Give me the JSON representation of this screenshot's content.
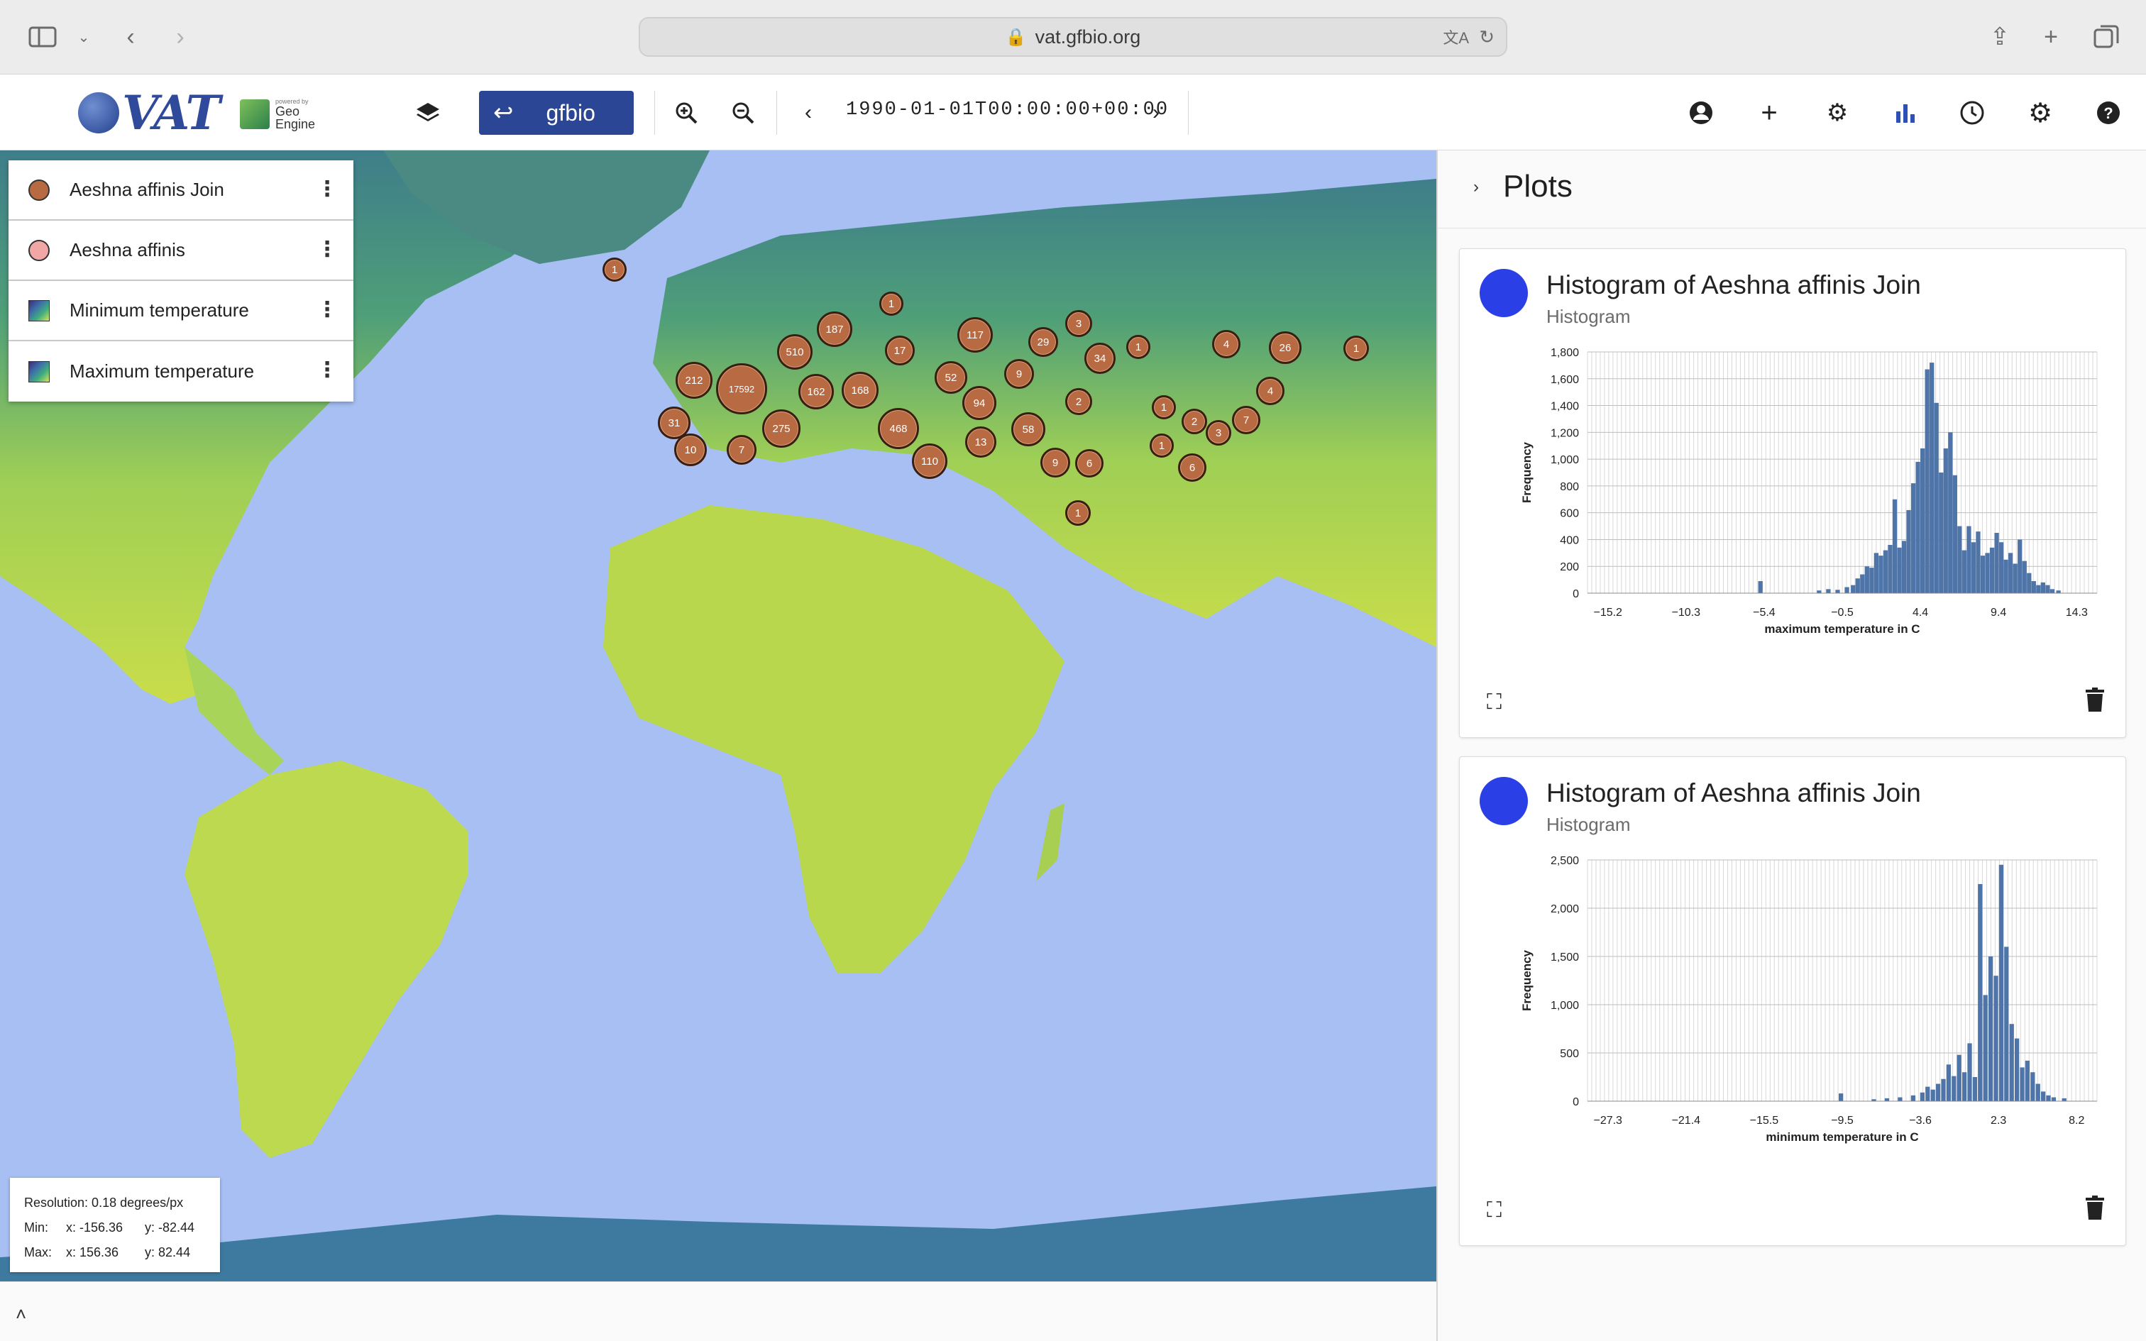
{
  "browser": {
    "url": "vat.gfbio.org"
  },
  "toolbar": {
    "gfbio_label": "gfbio",
    "time": "1990-01-01T00:00:00+00:00"
  },
  "layers": [
    {
      "name": "Aeshna affinis Join",
      "symbol": "point",
      "color": "#b86a43"
    },
    {
      "name": "Aeshna affinis",
      "symbol": "point",
      "color": "#f2a7a7"
    },
    {
      "name": "Minimum temperature",
      "symbol": "raster"
    },
    {
      "name": "Maximum temperature",
      "symbol": "raster"
    }
  ],
  "clusters": [
    {
      "label": "1"
    },
    {
      "label": "1"
    },
    {
      "label": "187"
    },
    {
      "label": "510"
    },
    {
      "label": "17"
    },
    {
      "label": "117"
    },
    {
      "label": "3"
    },
    {
      "label": "29"
    },
    {
      "label": "34"
    },
    {
      "label": "1"
    },
    {
      "label": "4"
    },
    {
      "label": "26"
    },
    {
      "label": "1"
    },
    {
      "label": "212"
    },
    {
      "label": "17592"
    },
    {
      "label": "162"
    },
    {
      "label": "168"
    },
    {
      "label": "52"
    },
    {
      "label": "9"
    },
    {
      "label": "94"
    },
    {
      "label": "2"
    },
    {
      "label": "1"
    },
    {
      "label": "2"
    },
    {
      "label": "7"
    },
    {
      "label": "4"
    },
    {
      "label": "3"
    },
    {
      "label": "31"
    },
    {
      "label": "275"
    },
    {
      "label": "468"
    },
    {
      "label": "58"
    },
    {
      "label": "13"
    },
    {
      "label": "1"
    },
    {
      "label": "10"
    },
    {
      "label": "7"
    },
    {
      "label": "110"
    },
    {
      "label": "9"
    },
    {
      "label": "6"
    },
    {
      "label": "6"
    },
    {
      "label": "1"
    }
  ],
  "info": {
    "resolution": "Resolution: 0.18 degrees/px",
    "min_label": "Min:",
    "min_x": "x: -156.36",
    "min_y": "y: -82.44",
    "max_label": "Max:",
    "max_x": "x: 156.36",
    "max_y": "y: 82.44"
  },
  "panel": {
    "title": "Plots"
  },
  "plots": [
    {
      "title": "Histogram of Aeshna affinis Join",
      "subtitle": "Histogram"
    },
    {
      "title": "Histogram of Aeshna affinis Join",
      "subtitle": "Histogram"
    }
  ],
  "chart_data": [
    {
      "type": "bar",
      "title": "",
      "xlabel": "maximum temperature in C",
      "ylabel": "Frequency",
      "ylim": [
        0,
        1800
      ],
      "y_ticks": [
        "0",
        "200",
        "400",
        "600",
        "800",
        "1,000",
        "1,200",
        "1,400",
        "1,600",
        "1,800"
      ],
      "x_ticks": [
        "−15.2",
        "−10.3",
        "−5.4",
        "−0.5",
        "4.4",
        "9.4",
        "14.3"
      ],
      "x_range": [
        -16.5,
        16.5
      ],
      "bins": [
        {
          "x": -5.3,
          "y": 90
        },
        {
          "x": -1.5,
          "y": 20
        },
        {
          "x": -0.9,
          "y": 30
        },
        {
          "x": -0.3,
          "y": 25
        },
        {
          "x": 0.3,
          "y": 45
        },
        {
          "x": 0.7,
          "y": 60
        },
        {
          "x": 1.0,
          "y": 110
        },
        {
          "x": 1.3,
          "y": 140
        },
        {
          "x": 1.6,
          "y": 200
        },
        {
          "x": 1.9,
          "y": 190
        },
        {
          "x": 2.2,
          "y": 300
        },
        {
          "x": 2.5,
          "y": 280
        },
        {
          "x": 2.8,
          "y": 320
        },
        {
          "x": 3.1,
          "y": 360
        },
        {
          "x": 3.4,
          "y": 700
        },
        {
          "x": 3.7,
          "y": 340
        },
        {
          "x": 4.0,
          "y": 390
        },
        {
          "x": 4.3,
          "y": 620
        },
        {
          "x": 4.6,
          "y": 820
        },
        {
          "x": 4.9,
          "y": 980
        },
        {
          "x": 5.2,
          "y": 1080
        },
        {
          "x": 5.5,
          "y": 1670
        },
        {
          "x": 5.8,
          "y": 1720
        },
        {
          "x": 6.1,
          "y": 1420
        },
        {
          "x": 6.4,
          "y": 900
        },
        {
          "x": 6.7,
          "y": 1080
        },
        {
          "x": 7.0,
          "y": 1200
        },
        {
          "x": 7.3,
          "y": 880
        },
        {
          "x": 7.6,
          "y": 500
        },
        {
          "x": 7.9,
          "y": 320
        },
        {
          "x": 8.2,
          "y": 500
        },
        {
          "x": 8.5,
          "y": 380
        },
        {
          "x": 8.8,
          "y": 460
        },
        {
          "x": 9.1,
          "y": 280
        },
        {
          "x": 9.4,
          "y": 300
        },
        {
          "x": 9.7,
          "y": 340
        },
        {
          "x": 10.0,
          "y": 450
        },
        {
          "x": 10.3,
          "y": 380
        },
        {
          "x": 10.6,
          "y": 250
        },
        {
          "x": 10.9,
          "y": 300
        },
        {
          "x": 11.2,
          "y": 220
        },
        {
          "x": 11.5,
          "y": 400
        },
        {
          "x": 11.8,
          "y": 240
        },
        {
          "x": 12.1,
          "y": 150
        },
        {
          "x": 12.4,
          "y": 90
        },
        {
          "x": 12.7,
          "y": 60
        },
        {
          "x": 13.0,
          "y": 80
        },
        {
          "x": 13.3,
          "y": 60
        },
        {
          "x": 13.6,
          "y": 30
        },
        {
          "x": 14.0,
          "y": 20
        }
      ]
    },
    {
      "type": "bar",
      "title": "",
      "xlabel": "minimum temperature in C",
      "ylabel": "Frequency",
      "ylim": [
        0,
        2500
      ],
      "y_ticks": [
        "0",
        "500",
        "1,000",
        "1,500",
        "2,000",
        "2,500"
      ],
      "x_ticks": [
        "−27.3",
        "−21.4",
        "−15.5",
        "−9.5",
        "−3.6",
        "2.3",
        "8.2"
      ],
      "x_range": [
        -28.8,
        10.0
      ],
      "bins": [
        {
          "x": -9.5,
          "y": 80
        },
        {
          "x": -7.0,
          "y": 20
        },
        {
          "x": -6.0,
          "y": 30
        },
        {
          "x": -5.0,
          "y": 40
        },
        {
          "x": -4.0,
          "y": 60
        },
        {
          "x": -3.3,
          "y": 90
        },
        {
          "x": -2.9,
          "y": 150
        },
        {
          "x": -2.5,
          "y": 120
        },
        {
          "x": -2.1,
          "y": 180
        },
        {
          "x": -1.7,
          "y": 230
        },
        {
          "x": -1.3,
          "y": 380
        },
        {
          "x": -0.9,
          "y": 260
        },
        {
          "x": -0.5,
          "y": 480
        },
        {
          "x": -0.1,
          "y": 300
        },
        {
          "x": 0.3,
          "y": 600
        },
        {
          "x": 0.7,
          "y": 250
        },
        {
          "x": 1.1,
          "y": 2250
        },
        {
          "x": 1.5,
          "y": 1100
        },
        {
          "x": 1.9,
          "y": 1500
        },
        {
          "x": 2.3,
          "y": 1300
        },
        {
          "x": 2.7,
          "y": 2450
        },
        {
          "x": 3.1,
          "y": 1600
        },
        {
          "x": 3.5,
          "y": 800
        },
        {
          "x": 3.9,
          "y": 650
        },
        {
          "x": 4.3,
          "y": 350
        },
        {
          "x": 4.7,
          "y": 420
        },
        {
          "x": 5.1,
          "y": 300
        },
        {
          "x": 5.5,
          "y": 180
        },
        {
          "x": 5.9,
          "y": 100
        },
        {
          "x": 6.3,
          "y": 60
        },
        {
          "x": 6.7,
          "y": 40
        },
        {
          "x": 7.5,
          "y": 30
        }
      ]
    }
  ]
}
